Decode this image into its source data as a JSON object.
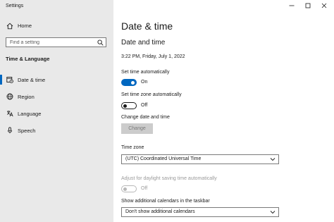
{
  "window": {
    "title": "Settings"
  },
  "sidebar": {
    "home_label": "Home",
    "search_placeholder": "Find a setting",
    "section_heading": "Time & Language",
    "items": [
      {
        "label": "Date & time",
        "icon": "calendar-clock-icon",
        "active": true
      },
      {
        "label": "Region",
        "icon": "globe-icon",
        "active": false
      },
      {
        "label": "Language",
        "icon": "language-icon",
        "active": false
      },
      {
        "label": "Speech",
        "icon": "microphone-icon",
        "active": false
      }
    ]
  },
  "main": {
    "page_title": "Date & time",
    "section_title": "Date and time",
    "current_datetime": "3:22 PM, Friday, July 1, 2022",
    "set_time_auto": {
      "label": "Set time automatically",
      "state": "On"
    },
    "set_tz_auto": {
      "label": "Set time zone automatically",
      "state": "Off"
    },
    "change_date_time": {
      "label": "Change date and time",
      "button": "Change"
    },
    "time_zone": {
      "label": "Time zone",
      "value": "(UTC) Coordinated Universal Time"
    },
    "dst": {
      "label": "Adjust for daylight saving time automatically",
      "state": "Off"
    },
    "calendars": {
      "label": "Show additional calendars in the taskbar",
      "value": "Don't show additional calendars"
    }
  },
  "colors": {
    "accent": "#0067c0",
    "sidebar_bg": "#e9e9e9"
  }
}
